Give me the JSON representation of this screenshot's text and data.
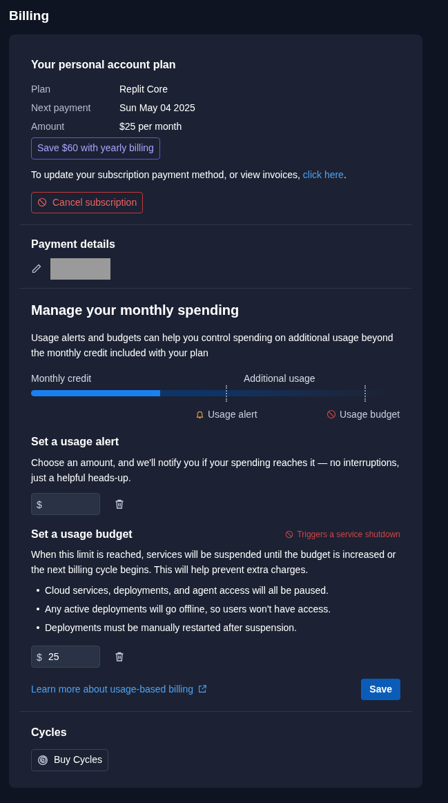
{
  "page_title": "Billing",
  "plan": {
    "heading": "Your personal account plan",
    "rows": [
      {
        "label": "Plan",
        "value": "Replit Core"
      },
      {
        "label": "Next payment",
        "value": "Sun May 04 2025"
      },
      {
        "label": "Amount",
        "value": "$25 per month"
      }
    ],
    "promo_button": "Save $60 with yearly billing",
    "update_text": "To update your subscription payment method, or view invoices, ",
    "update_link": "click here",
    "update_end": ".",
    "cancel_button": "Cancel subscription"
  },
  "payment_details": {
    "heading": "Payment details"
  },
  "spending": {
    "heading": "Manage your monthly spending",
    "description": "Usage alerts and budgets can help you control spending on additional usage beyond the monthly credit included with your plan",
    "meter": {
      "left_label": "Monthly credit",
      "right_label": "Additional usage",
      "level": 0.36,
      "alert_label": "Usage alert",
      "budget_label": "Usage budget"
    },
    "alert": {
      "heading": "Set a usage alert",
      "description": "Choose an amount, and we'll notify you if your spending reaches it — no interruptions, just a helpful heads-up.",
      "prefix": "$"
    },
    "budget": {
      "heading": "Set a usage budget",
      "warning": "Triggers a service shutdown",
      "description": "When this limit is reached, services will be suspended until the budget is increased or the next billing cycle begins. This will help prevent extra charges.",
      "bullets": [
        "Cloud services, deployments, and agent access will all be paused.",
        "Any active deployments will go offline, so users won't have access.",
        "Deployments must be manually restarted after suspension."
      ],
      "prefix": "$",
      "value": "25"
    },
    "learn_link": "Learn more about usage-based billing",
    "save_button": "Save"
  },
  "cycles": {
    "heading": "Cycles",
    "button": "Buy Cycles"
  }
}
